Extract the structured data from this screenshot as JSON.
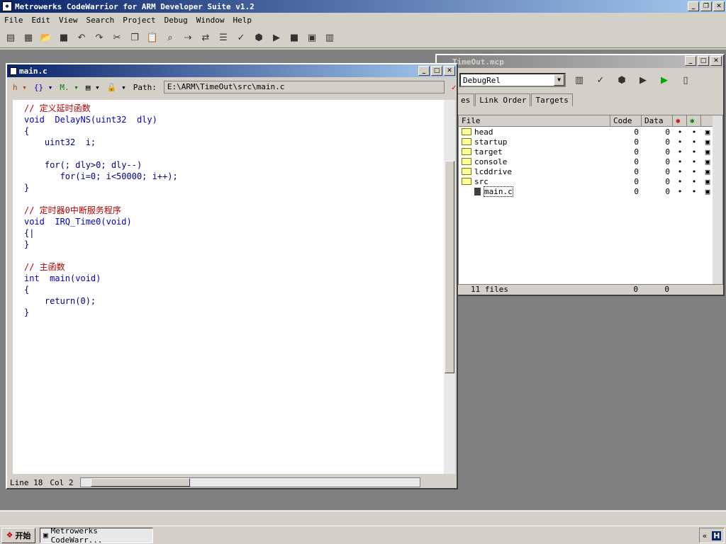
{
  "app": {
    "title": "Metrowerks CodeWarrior for ARM Developer Suite v1.2"
  },
  "menu": [
    "File",
    "Edit",
    "View",
    "Search",
    "Project",
    "Debug",
    "Window",
    "Help"
  ],
  "project": {
    "title": "TimeOut.mcp",
    "target": "DebugRel",
    "tabs": [
      "es",
      "Link Order",
      "Targets"
    ],
    "columns": {
      "file": "File",
      "code": "Code",
      "data": "Data"
    },
    "files": [
      {
        "name": "head",
        "code": "0",
        "data": "0",
        "kind": "folder"
      },
      {
        "name": "startup",
        "code": "0",
        "data": "0",
        "kind": "folder"
      },
      {
        "name": "target",
        "code": "0",
        "data": "0",
        "kind": "folder"
      },
      {
        "name": "console",
        "code": "0",
        "data": "0",
        "kind": "folder"
      },
      {
        "name": "lcddrive",
        "code": "0",
        "data": "0",
        "kind": "folder"
      },
      {
        "name": "src",
        "code": "0",
        "data": "0",
        "kind": "folder-open"
      },
      {
        "name": "main.c",
        "code": "0",
        "data": "0",
        "kind": "file"
      }
    ],
    "footer": {
      "count": "11 files",
      "code": "0",
      "data": "0"
    }
  },
  "editor": {
    "title": "main.c",
    "path_label": "Path:",
    "path": "E:\\ARM\\TimeOut\\src\\main.c",
    "code_lines": [
      {
        "text": "// 定义延时函数",
        "cls": "comment"
      },
      {
        "text": "void  DelayNS(uint32  dly)",
        "cls": "kw"
      },
      {
        "text": "{",
        "cls": ""
      },
      {
        "text": "    uint32  i;",
        "cls": ""
      },
      {
        "text": "",
        "cls": ""
      },
      {
        "text": "    for(; dly>0; dly--)",
        "cls": ""
      },
      {
        "text": "       for(i=0; i<50000; i++);",
        "cls": ""
      },
      {
        "text": "}",
        "cls": ""
      },
      {
        "text": "",
        "cls": ""
      },
      {
        "text": "// 定时器0中断服务程序",
        "cls": "comment"
      },
      {
        "text": "void  IRQ_Time0(void)",
        "cls": "kw"
      },
      {
        "text": "{|",
        "cls": ""
      },
      {
        "text": "}",
        "cls": ""
      },
      {
        "text": "",
        "cls": ""
      },
      {
        "text": "// 主函数",
        "cls": "comment"
      },
      {
        "text": "int  main(void)",
        "cls": "kw"
      },
      {
        "text": "{",
        "cls": ""
      },
      {
        "text": "    return(0);",
        "cls": ""
      },
      {
        "text": "}",
        "cls": ""
      }
    ],
    "status_line": "Line 18",
    "status_col": "Col 2"
  },
  "taskbar": {
    "start": "开始",
    "task": "Metrowerks CodeWarr..."
  }
}
